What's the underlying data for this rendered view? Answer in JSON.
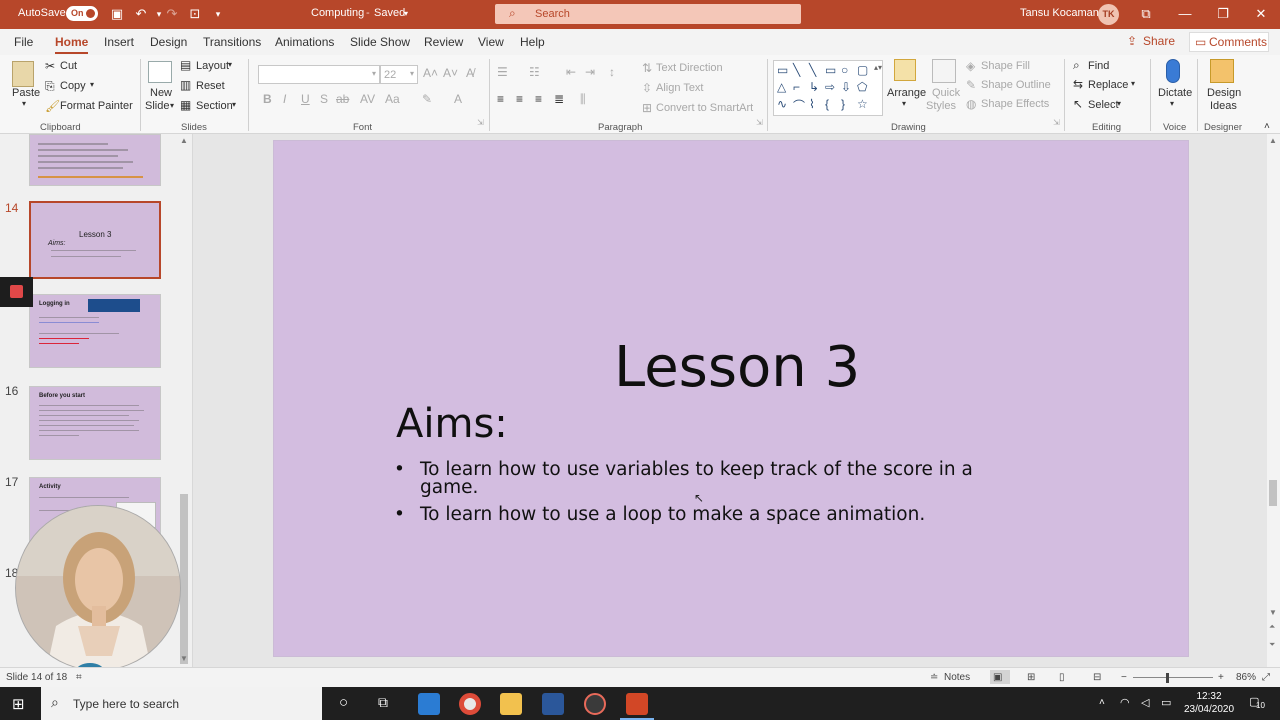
{
  "titlebar": {
    "autosave_label": "AutoSave",
    "autosave_state": "On",
    "doc_title": "Computing",
    "doc_status": "Saved",
    "search_placeholder": "Search",
    "user_name": "Tansu Kocaman",
    "user_initials": "TK"
  },
  "menu": {
    "tabs": [
      "File",
      "Home",
      "Insert",
      "Design",
      "Transitions",
      "Animations",
      "Slide Show",
      "Review",
      "View",
      "Help"
    ],
    "active": "Home",
    "share": "Share",
    "comments": "Comments"
  },
  "ribbon": {
    "clipboard": {
      "label": "Clipboard",
      "paste": "Paste",
      "cut": "Cut",
      "copy": "Copy",
      "format_painter": "Format Painter"
    },
    "slides": {
      "label": "Slides",
      "new_slide_1": "New",
      "new_slide_2": "Slide",
      "layout": "Layout",
      "reset": "Reset",
      "section": "Section"
    },
    "font": {
      "label": "Font",
      "size": "22"
    },
    "paragraph": {
      "label": "Paragraph",
      "text_direction": "Text Direction",
      "align_text": "Align Text",
      "convert": "Convert to SmartArt"
    },
    "drawing": {
      "label": "Drawing",
      "arrange": "Arrange",
      "quick_1": "Quick",
      "quick_2": "Styles",
      "fill": "Shape Fill",
      "outline": "Shape Outline",
      "effects": "Shape Effects"
    },
    "editing": {
      "label": "Editing",
      "find": "Find",
      "replace": "Replace",
      "select": "Select"
    },
    "voice": {
      "label": "Voice",
      "dictate": "Dictate"
    },
    "designer": {
      "label": "Designer",
      "design_1": "Design",
      "design_2": "Ideas"
    }
  },
  "thumbnails": [
    {
      "num": "",
      "title": "",
      "lines": [
        "• Answer these questions",
        "Can you describe your game using the words 'if', 'then' and 'condition'",
        "If you could improve your app, what would you make it do?",
        "What does the function 'tap' do?",
        "Explain what you have done using the words 'then' and 'sequence'",
        "Challenge: challenge a family member to play your App Fever app"
      ],
      "selected": false
    },
    {
      "num": "14",
      "title": "Lesson 3",
      "subtitle": "Aims:",
      "lines": [
        "• To learn how to use variables to keep track of the score in a game.",
        "• To learn how to use a loop to make a space animation."
      ],
      "selected": true
    },
    {
      "num": "",
      "title": "Logging in",
      "logo": "Discovery | CODING",
      "lines": [
        "• First, go to this website:",
        "https://www.discoveryeducation.co.uk/",
        "• Click on 'coding' and enter your login details.",
        "• USERNAME: student0000",
        "• PASSWORD: coding"
      ],
      "selected": false
    },
    {
      "num": "16",
      "title": "Before you start",
      "lines": [
        "• Remember to follow the instructions carefully",
        "• Make notes if you need them, there will be a quiz at the end of the week!",
        "• See if you can ask someone else at home to have a go at testing your app to look for bugs.",
        "• Don't forget to practise your quiz knowledge before the quiz today!"
      ],
      "selected": false
    },
    {
      "num": "17",
      "title": "Activity",
      "lines": [
        "• Click on 'block coding' and go to 'Year 5 Starter Unit'",
        "• Complete Lesson"
      ],
      "selected": false
    },
    {
      "num": "18",
      "title": "",
      "lines": [],
      "selected": false
    }
  ],
  "slide": {
    "title": "Lesson 3",
    "subtitle": "Aims:",
    "bullets": [
      {
        "line1": "To learn how to use variables to keep track of the score in a",
        "line2": "game."
      },
      {
        "line1": "To learn how to use a loop to make a space animation.",
        "line2": ""
      }
    ],
    "bg_color": "#d3bde0"
  },
  "status": {
    "slide_info": "Slide 14 of 18",
    "notes": "Notes",
    "zoom": "86%"
  },
  "taskbar": {
    "search_placeholder": "Type here to search",
    "time": "12:32",
    "date": "23/04/2020",
    "notif_count": "10"
  },
  "colors": {
    "accent": "#b7472a",
    "slide_bg": "#d3bde0"
  }
}
